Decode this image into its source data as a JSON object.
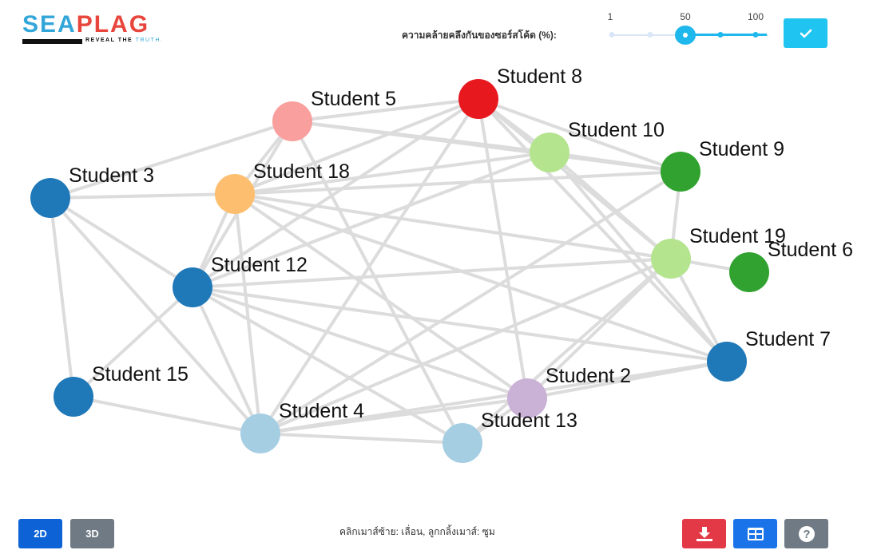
{
  "logo": {
    "part1": "SEA",
    "part2": "PLAG",
    "tagline": "REVEAL THE",
    "tagline_accent": "TRUTH."
  },
  "similarity": {
    "label": "ความคล้ายคลึงกันของซอร์สโค้ด (%):",
    "ticks": [
      "1",
      "50",
      "100"
    ],
    "value": 50,
    "apply_icon": "check-icon"
  },
  "graph": {
    "nodes": [
      {
        "id": "s8",
        "label": "Student 8",
        "color": "#e8181f"
      },
      {
        "id": "s5",
        "label": "Student 5",
        "color": "#f99f9e"
      },
      {
        "id": "s10",
        "label": "Student 10",
        "color": "#b5e48f"
      },
      {
        "id": "s9",
        "label": "Student 9",
        "color": "#31a22f"
      },
      {
        "id": "s3",
        "label": "Student 3",
        "color": "#1f78b8"
      },
      {
        "id": "s18",
        "label": "Student 18",
        "color": "#fdbf6f"
      },
      {
        "id": "s19",
        "label": "Student 19",
        "color": "#b5e48f"
      },
      {
        "id": "s6",
        "label": "Student 6",
        "color": "#31a22f"
      },
      {
        "id": "s12",
        "label": "Student 12",
        "color": "#1f78b8"
      },
      {
        "id": "s7",
        "label": "Student 7",
        "color": "#1f78b8"
      },
      {
        "id": "s15",
        "label": "Student 15",
        "color": "#1f78b8"
      },
      {
        "id": "s2",
        "label": "Student 2",
        "color": "#cab2d6"
      },
      {
        "id": "s4",
        "label": "Student 4",
        "color": "#a6cee3"
      },
      {
        "id": "s13",
        "label": "Student 13",
        "color": "#a6cee3"
      }
    ],
    "edges": [
      [
        "s8",
        "s5"
      ],
      [
        "s8",
        "s10"
      ],
      [
        "s8",
        "s9"
      ],
      [
        "s8",
        "s18"
      ],
      [
        "s8",
        "s12"
      ],
      [
        "s8",
        "s4"
      ],
      [
        "s8",
        "s2"
      ],
      [
        "s8",
        "s7"
      ],
      [
        "s8",
        "s19"
      ],
      [
        "s5",
        "s3"
      ],
      [
        "s5",
        "s10"
      ],
      [
        "s5",
        "s9"
      ],
      [
        "s5",
        "s12"
      ],
      [
        "s5",
        "s13"
      ],
      [
        "s5",
        "s18"
      ],
      [
        "s10",
        "s9"
      ],
      [
        "s10",
        "s12"
      ],
      [
        "s10",
        "s7"
      ],
      [
        "s10",
        "s19"
      ],
      [
        "s10",
        "s18"
      ],
      [
        "s9",
        "s19"
      ],
      [
        "s9",
        "s4"
      ],
      [
        "s9",
        "s18"
      ],
      [
        "s3",
        "s18"
      ],
      [
        "s3",
        "s12"
      ],
      [
        "s3",
        "s4"
      ],
      [
        "s3",
        "s15"
      ],
      [
        "s18",
        "s12"
      ],
      [
        "s18",
        "s4"
      ],
      [
        "s18",
        "s2"
      ],
      [
        "s18",
        "s7"
      ],
      [
        "s18",
        "s19"
      ],
      [
        "s19",
        "s6"
      ],
      [
        "s19",
        "s7"
      ],
      [
        "s19",
        "s12"
      ],
      [
        "s19",
        "s2"
      ],
      [
        "s19",
        "s4"
      ],
      [
        "s19",
        "s13"
      ],
      [
        "s12",
        "s7"
      ],
      [
        "s12",
        "s2"
      ],
      [
        "s12",
        "s4"
      ],
      [
        "s12",
        "s15"
      ],
      [
        "s12",
        "s13"
      ],
      [
        "s7",
        "s2"
      ],
      [
        "s7",
        "s4"
      ],
      [
        "s15",
        "s4"
      ],
      [
        "s2",
        "s4"
      ],
      [
        "s2",
        "s13"
      ],
      [
        "s4",
        "s13"
      ]
    ]
  },
  "bottom": {
    "btn_2d": "2D",
    "btn_3d": "3D",
    "hint": "คลิกเมาส์ซ้าย: เลื่อน, ลูกกลิ้งเมาส์: ซูม",
    "download_icon": "download-icon",
    "table_icon": "table-icon",
    "help_icon": "question-icon"
  }
}
